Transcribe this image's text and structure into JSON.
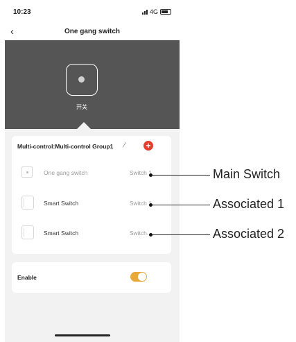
{
  "status_bar": {
    "time": "10:23",
    "network": "4G"
  },
  "nav": {
    "title": "One gang switch"
  },
  "device": {
    "label": "开关"
  },
  "group": {
    "title": "Multi-control:Multi-control Group1",
    "rows": [
      {
        "name": "One gang switch",
        "status": "Switch 1"
      },
      {
        "name": "Smart Switch",
        "status": "Switch 1"
      },
      {
        "name": "Smart Switch",
        "status": "Switch..."
      }
    ]
  },
  "enable": {
    "label": "Enable",
    "on": true
  },
  "callouts": [
    {
      "label": "Main Switch"
    },
    {
      "label": "Associated 1"
    },
    {
      "label": "Associated 2"
    }
  ],
  "colors": {
    "accent_orange": "#e8a83a",
    "add_red": "#e3402f",
    "panel_gray": "#555555"
  }
}
